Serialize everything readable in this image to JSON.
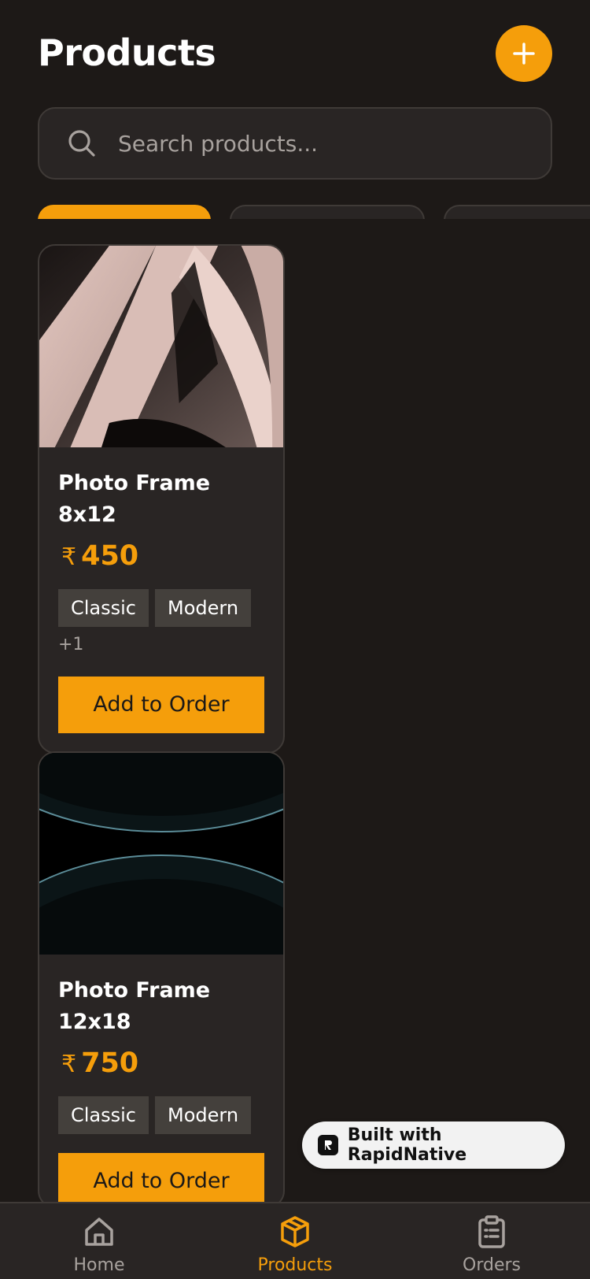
{
  "header": {
    "title": "Products"
  },
  "search": {
    "placeholder": "Search products..."
  },
  "products": [
    {
      "name": "Photo Frame 8x12",
      "currency": "₹",
      "price": "450",
      "tags": [
        "Classic",
        "Modern"
      ],
      "more": "+1",
      "button": "Add to Order"
    },
    {
      "name": "Photo Frame 12x18",
      "currency": "₹",
      "price": "750",
      "tags": [
        "Classic",
        "Modern"
      ],
      "button": "Add to Order"
    }
  ],
  "badge": {
    "label": "Built with RapidNative"
  },
  "tabs": [
    {
      "label": "Home",
      "icon": "home-icon"
    },
    {
      "label": "Products",
      "icon": "package-icon",
      "active": true
    },
    {
      "label": "Orders",
      "icon": "clipboard-list-icon"
    }
  ],
  "colors": {
    "accent": "#f59e0b",
    "background": "#1d1917",
    "surface": "#292524",
    "muted": "#a8a29e"
  }
}
